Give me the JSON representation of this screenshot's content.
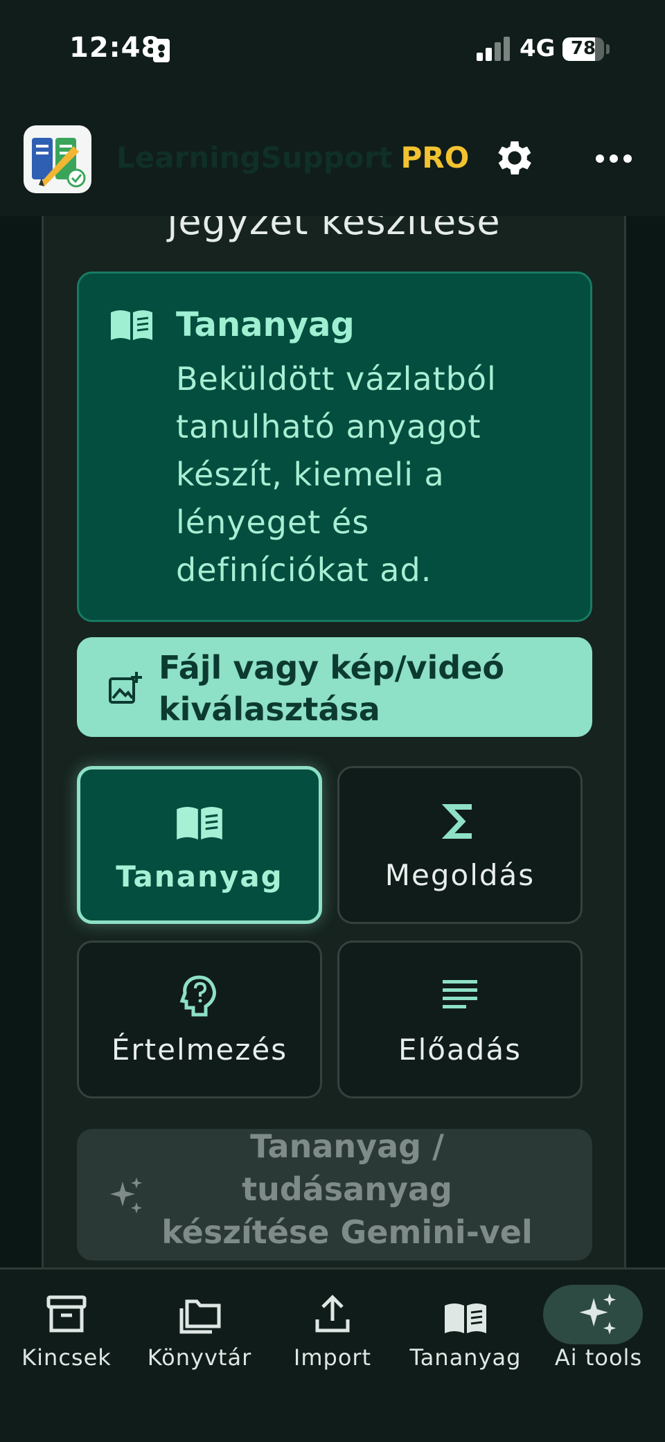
{
  "status_bar": {
    "time": "12:48",
    "network": "4G",
    "battery": "78",
    "battery_level": 0.78
  },
  "app_bar": {
    "brand_main": "LearningSupport",
    "brand_badge": "PRO"
  },
  "page": {
    "title": "jegyzet készítése"
  },
  "info_card": {
    "title": "Tananyag",
    "description": "Beküldött vázlatból tanulható anyagot készít, kiemeli a lényeget és definíciókat ad."
  },
  "file_button": {
    "label": "Fájl vagy kép/videó kiválasztása"
  },
  "modes": [
    {
      "label": "Tananyag",
      "icon": "book-icon",
      "active": true
    },
    {
      "label": "Megoldás",
      "icon": "sigma-icon",
      "active": false
    },
    {
      "label": "Értelmezés",
      "icon": "head-question-icon",
      "active": false
    },
    {
      "label": "Előadás",
      "icon": "lines-icon",
      "active": false
    }
  ],
  "generate_button": {
    "label": "Tananyag / tudásanyag készítése Gemini-vel",
    "enabled": false
  },
  "bottom_nav": [
    {
      "label": "Kincsek",
      "icon": "archive-icon"
    },
    {
      "label": "Könyvtár",
      "icon": "folders-icon"
    },
    {
      "label": "Import",
      "icon": "upload-icon"
    },
    {
      "label": "Tananyag",
      "icon": "book-icon"
    },
    {
      "label": "Ai tools",
      "icon": "sparkles-icon",
      "active": true
    }
  ],
  "colors": {
    "accent": "#8ee0c6",
    "card": "#034e3e",
    "pro": "#f2c230",
    "background": "#0b1714"
  }
}
